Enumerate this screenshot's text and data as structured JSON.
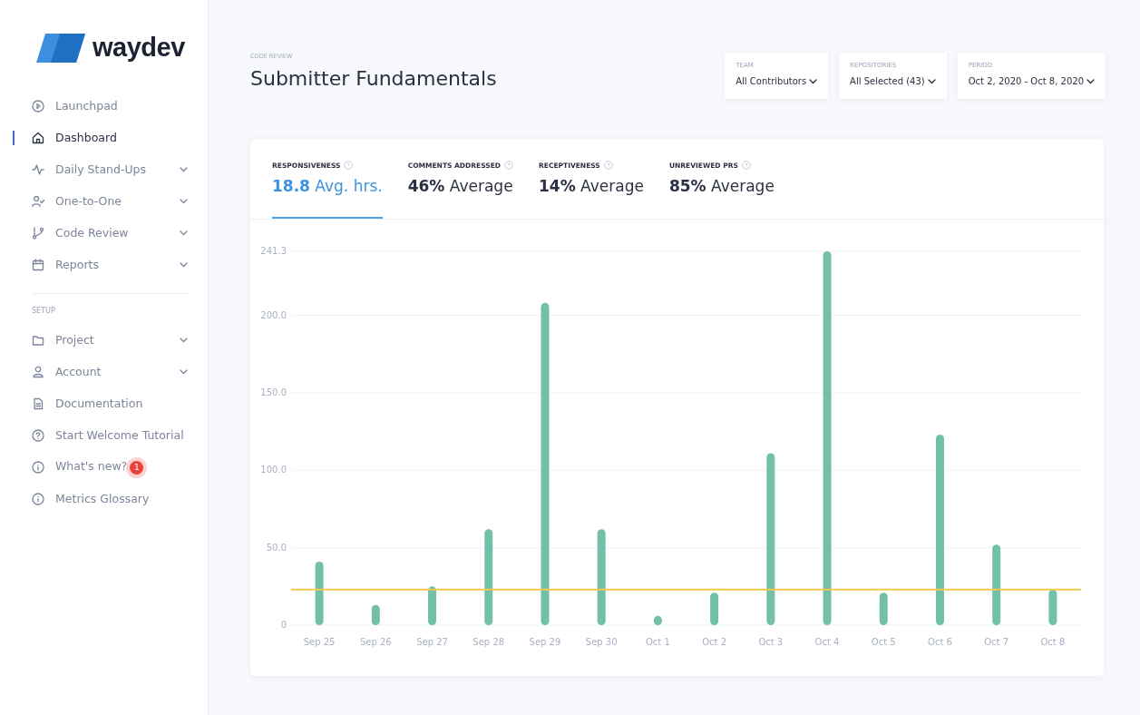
{
  "sidebar": {
    "logo": "waydev",
    "items": [
      {
        "label": "Launchpad",
        "selected": false,
        "has_submenu": false
      },
      {
        "label": "Dashboard",
        "selected": true,
        "has_submenu": false
      },
      {
        "label": "Daily Stand-Ups",
        "selected": false,
        "has_submenu": true
      },
      {
        "label": "One-to-One",
        "selected": false,
        "has_submenu": true
      },
      {
        "label": "Code Review",
        "selected": false,
        "has_submenu": true
      },
      {
        "label": "Reports",
        "selected": false,
        "has_submenu": true
      }
    ],
    "setup_heading": "SETUP",
    "setup_items": [
      {
        "label": "Project",
        "has_submenu": true
      },
      {
        "label": "Account",
        "has_submenu": true
      },
      {
        "label": "Documentation",
        "has_submenu": false
      },
      {
        "label": "Start Welcome Tutorial",
        "has_submenu": false
      },
      {
        "label": "What's new?",
        "has_submenu": false,
        "badge": "1"
      },
      {
        "label": "Metrics Glossary",
        "has_submenu": false
      }
    ]
  },
  "header": {
    "section": "CODE REVIEW",
    "title": "Submitter Fundamentals",
    "filters": [
      {
        "label": "TEAM",
        "value": "All Contributors"
      },
      {
        "label": "REPOSITORIES",
        "value": "All Selected (43)"
      },
      {
        "label": "PERIOD",
        "value": "Oct 2, 2020 - Oct 8, 2020"
      }
    ]
  },
  "metrics": [
    {
      "label": "RESPONSIVENESS",
      "value": "18.8",
      "unit": "Avg. hrs.",
      "selected": true
    },
    {
      "label": "COMMENTS ADDRESSED",
      "value": "46%",
      "unit": "Average",
      "selected": false
    },
    {
      "label": "RECEPTIVENESS",
      "value": "14%",
      "unit": "Average",
      "selected": false
    },
    {
      "label": "UNREVIEWED PRS",
      "value": "85%",
      "unit": "Average",
      "selected": false
    }
  ],
  "chart_data": {
    "type": "bar",
    "categories": [
      "Sep 25",
      "Sep 26",
      "Sep 27",
      "Sep 28",
      "Sep 29",
      "Sep 30",
      "Oct 1",
      "Oct 2",
      "Oct 3",
      "Oct 4",
      "Oct 5",
      "Oct 6",
      "Oct 7",
      "Oct 8"
    ],
    "values": [
      41,
      13,
      25,
      62,
      208,
      62,
      6,
      21,
      111,
      241.3,
      21,
      123,
      52,
      23
    ],
    "grid": true,
    "ylim": [
      0,
      241.3
    ],
    "yticks": [
      {
        "value": 0,
        "label": "0"
      },
      {
        "value": 50,
        "label": "50.0"
      },
      {
        "value": 100,
        "label": "100.0"
      },
      {
        "value": 150,
        "label": "150.0"
      },
      {
        "value": 200,
        "label": "200.0"
      },
      {
        "value": 241.3,
        "label": "241.3"
      }
    ],
    "ref_lines": [
      {
        "axis": "y",
        "value": 23,
        "color": "#f2c94c"
      }
    ]
  }
}
